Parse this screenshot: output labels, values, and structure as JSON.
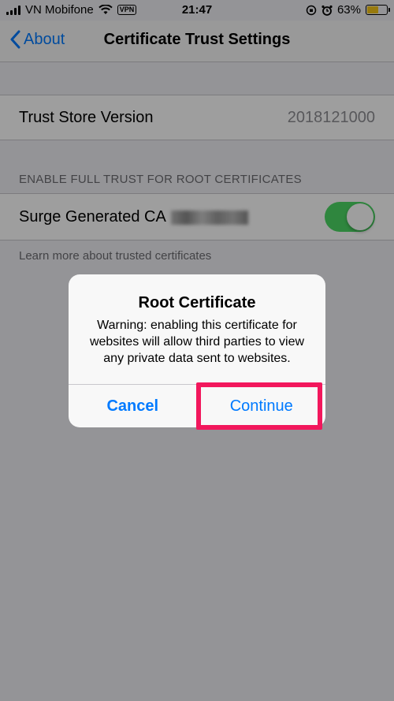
{
  "status_bar": {
    "carrier": "VN Mobifone",
    "vpn": "VPN",
    "time": "21:47",
    "battery": "63%",
    "battery_level": 0.63
  },
  "nav": {
    "back_label": "About",
    "title": "Certificate Trust Settings"
  },
  "trust_store": {
    "label": "Trust Store Version",
    "value": "2018121000"
  },
  "section": {
    "header": "ENABLE FULL TRUST FOR ROOT CERTIFICATES",
    "cert_label": "Surge Generated CA",
    "toggle_on": true,
    "footer": "Learn more about trusted certificates"
  },
  "alert": {
    "title": "Root Certificate",
    "message": "Warning: enabling this certificate for websites will allow third parties to view any private data sent to websites.",
    "cancel": "Cancel",
    "continue": "Continue"
  },
  "colors": {
    "accent": "#007aff",
    "toggle": "#4cd964",
    "highlight": "#f2175c"
  }
}
